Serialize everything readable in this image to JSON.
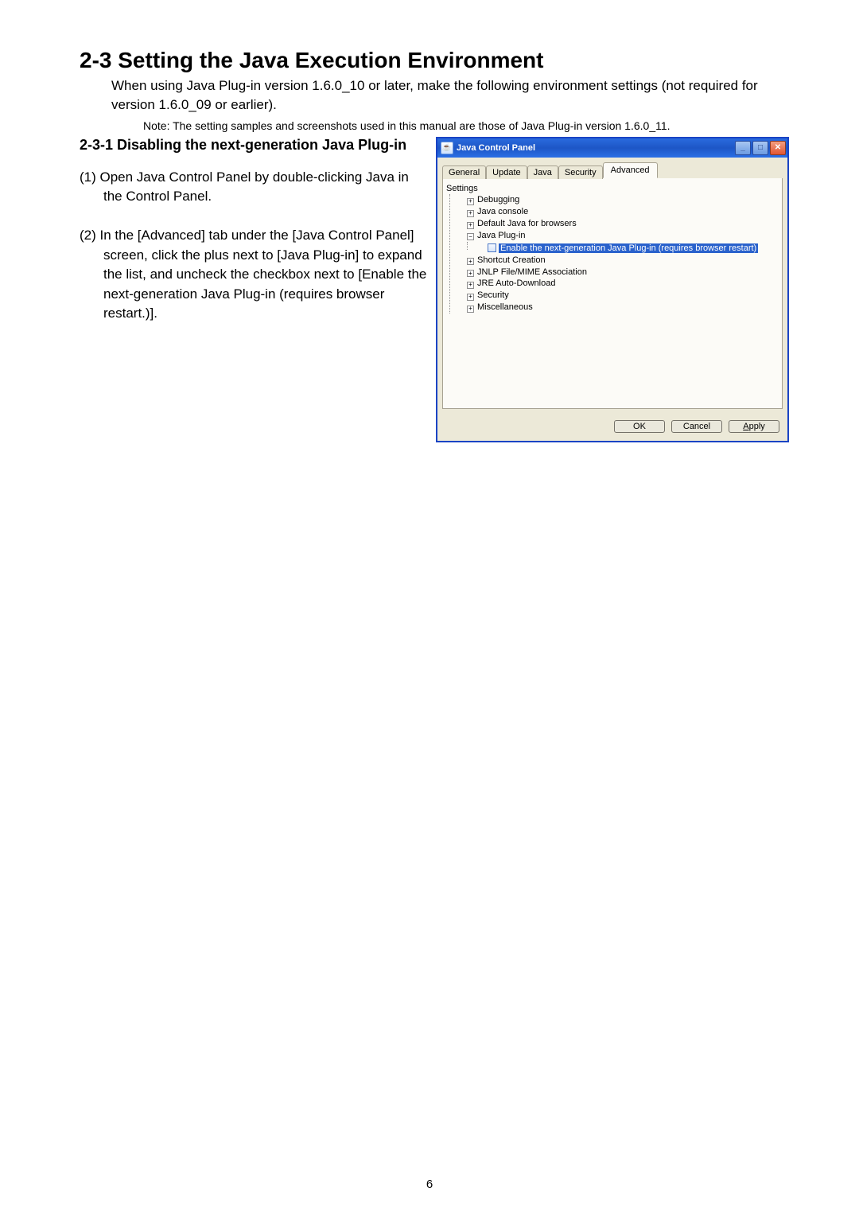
{
  "section_title": "2-3 Setting the Java Execution Environment",
  "intro": "When using Java Plug-in version 1.6.0_10 or later, make the following environment settings (not required for version 1.6.0_09 or earlier).",
  "note": "Note: The setting samples and screenshots used in this manual are those of Java Plug-in version 1.6.0_11.",
  "subheading": "2-3-1  Disabling the next-generation Java Plug-in",
  "step1": "(1) Open Java Control Panel by double-clicking Java in the Control Panel.",
  "step2": "(2) In the [Advanced] tab under the [Java Control Panel] screen, click the plus next to [Java Plug-in]  to expand the list, and uncheck the checkbox next to [Enable the next-generation Java Plug-in  (requires browser restart.)].",
  "dialog": {
    "title": "Java Control Panel",
    "tabs": [
      "General",
      "Update",
      "Java",
      "Security",
      "Advanced"
    ],
    "active_tab": "Advanced",
    "root_label": "Settings",
    "nodes": {
      "debugging": "Debugging",
      "java_console": "Java console",
      "default_java": "Default Java for browsers",
      "java_plugin": "Java Plug-in",
      "enable_next_gen": "Enable the next-generation Java Plug-in (requires browser restart)",
      "shortcut": "Shortcut Creation",
      "jnlp": "JNLP File/MIME Association",
      "jre_auto": "JRE Auto-Download",
      "security": "Security",
      "misc": "Miscellaneous"
    },
    "buttons": {
      "ok": "OK",
      "cancel": "Cancel",
      "apply": "Apply"
    }
  },
  "page_number": "6"
}
